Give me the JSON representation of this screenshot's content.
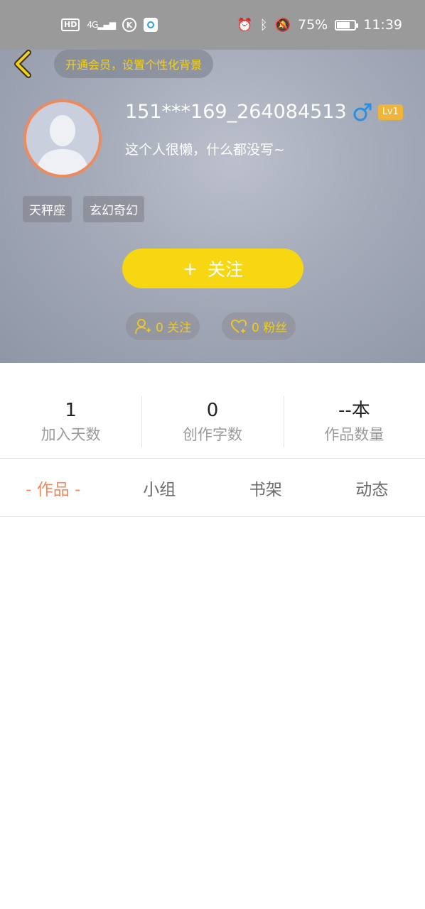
{
  "status_bar": {
    "hd": "HD",
    "network": "4G",
    "k_badge": "K",
    "battery_percent": "75%",
    "battery_level": 0.75,
    "time": "11:39"
  },
  "header": {
    "vip_prompt": "开通会员，设置个性化背景",
    "username": "151***169_264084513",
    "gender_symbol": "♂",
    "level": "Lv1",
    "bio": "这个人很懒，什么都没写~",
    "tags": [
      "天秤座",
      "玄幻奇幻"
    ],
    "follow_button": {
      "plus": "+",
      "label": "关注"
    },
    "following_count": "0 关注",
    "fans_count": "0 粉丝"
  },
  "stats": [
    {
      "value": "1",
      "label": "加入天数"
    },
    {
      "value": "0",
      "label": "创作字数"
    },
    {
      "value": "--本",
      "label": "作品数量"
    }
  ],
  "tabs": [
    {
      "label": "- 作品 -",
      "active": true
    },
    {
      "label": "小组",
      "active": false
    },
    {
      "label": "书架",
      "active": false
    },
    {
      "label": "动态",
      "active": false
    }
  ],
  "colors": {
    "accent": "#f7d712",
    "tab_active": "#ef8a5c",
    "level_badge": "#f0b43a",
    "gender_male": "#2a8fe0"
  }
}
